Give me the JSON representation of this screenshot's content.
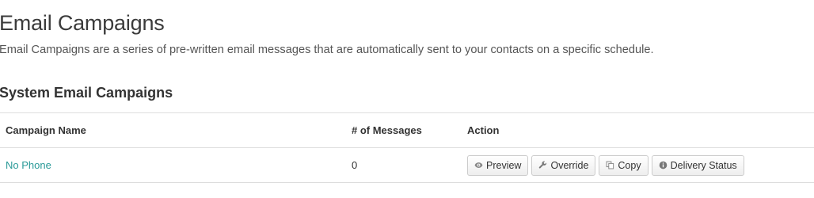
{
  "page": {
    "title": "Email Campaigns",
    "description": "Email Campaigns are a series of pre-written email messages that are automatically sent to your contacts on a specific schedule."
  },
  "section": {
    "title": "System Email Campaigns"
  },
  "table": {
    "headers": {
      "name": "Campaign Name",
      "count": "# of Messages",
      "action": "Action"
    },
    "rows": [
      {
        "name": "No Phone",
        "count": "0",
        "actions": {
          "preview": "Preview",
          "override": "Override",
          "copy": "Copy",
          "delivery_status": "Delivery Status"
        }
      }
    ]
  },
  "colors": {
    "link": "#2a9a98",
    "border": "#dddddd"
  },
  "icons": {
    "preview": "eye-icon",
    "override": "wrench-icon",
    "copy": "copy-icon",
    "delivery_status": "info-circle-icon"
  }
}
